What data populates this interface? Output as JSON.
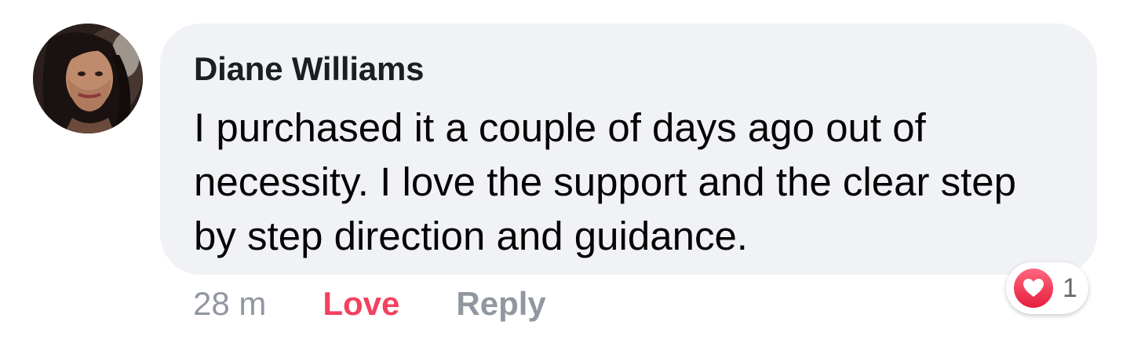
{
  "comment": {
    "author": "Diane Williams",
    "text": "I purchased it a couple of days ago out of necessity. I love the support and the clear step by step direction and guidance.",
    "timestamp": "28 m",
    "love_label": "Love",
    "reply_label": "Reply",
    "reaction_icon": "heart-icon",
    "reaction_count": "1"
  },
  "colors": {
    "bubble": "#f0f2f5",
    "love": "#f3425f",
    "muted": "#9197a0"
  }
}
